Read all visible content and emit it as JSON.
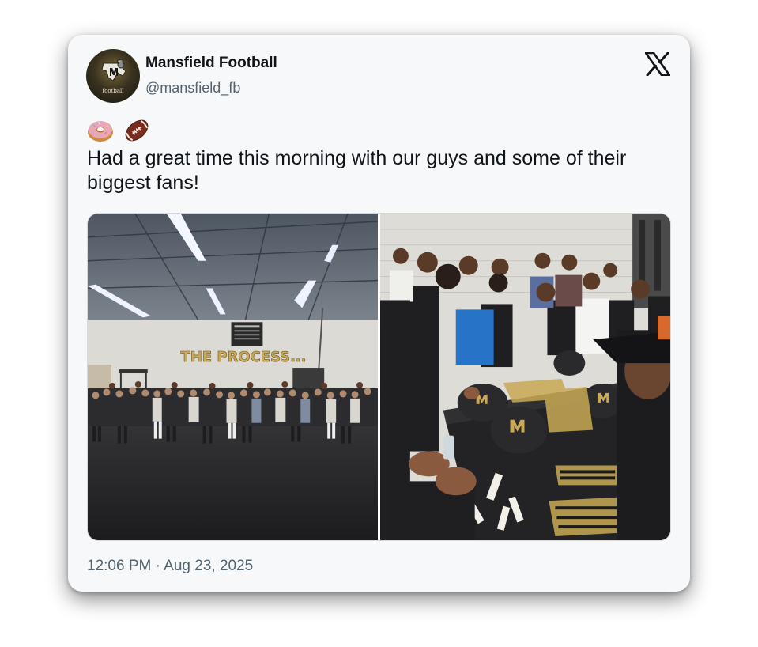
{
  "tweet": {
    "account_name": "Mansfield Football",
    "handle": "@mansfield_fb",
    "avatar_text": "football",
    "emojis": [
      "doughnut-emoji",
      "american-football-emoji"
    ],
    "text": "Had a great time this morning with our guys and some of their biggest fans!",
    "timestamp": "12:06 PM · Aug 23, 2025",
    "platform_icon": "x-logo-icon"
  },
  "media": {
    "photos": [
      {
        "label": "team-group-photo",
        "banner_text": "THE PROCESS..."
      },
      {
        "label": "helmet-decal-photo"
      }
    ]
  },
  "colors": {
    "card_background": "#f7f8f9",
    "primary_text": "#0f1419",
    "secondary_text": "#536471",
    "banner_gold": "#c9a955"
  }
}
